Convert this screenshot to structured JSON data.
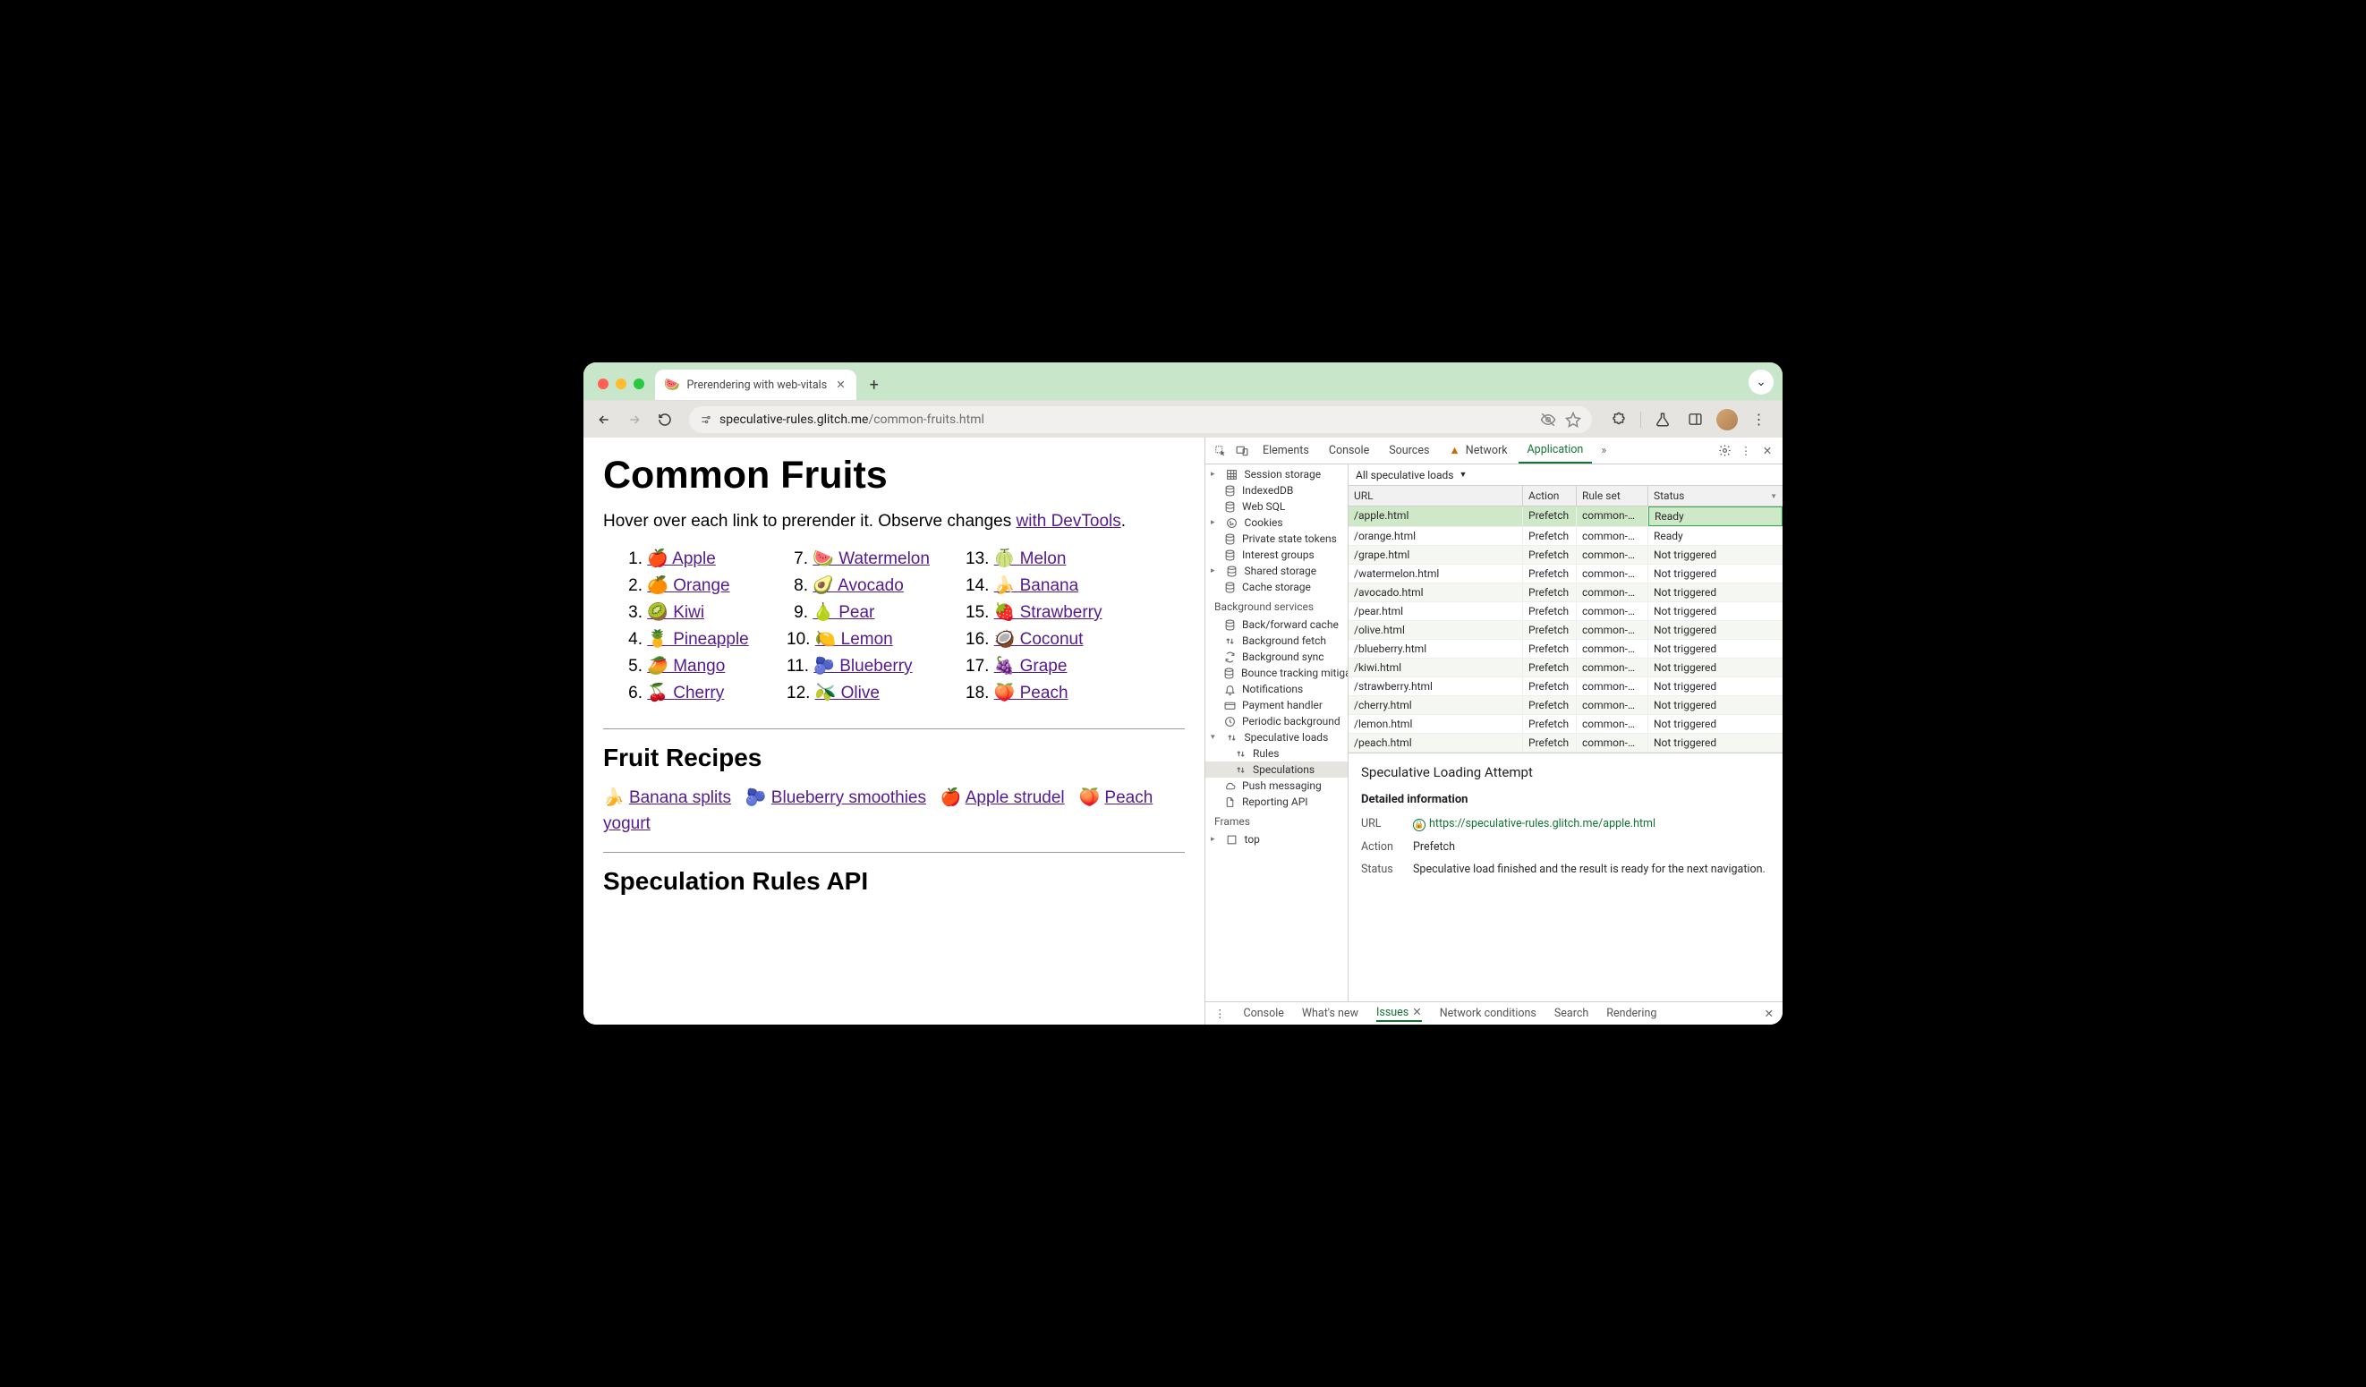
{
  "tab": {
    "title": "Prerendering with web-vitals",
    "favicon": "🍉"
  },
  "omnibox": {
    "host": "speculative-rules.glitch.me",
    "path": "/common-fruits.html"
  },
  "page": {
    "h1": "Common Fruits",
    "intro_before": "Hover over each link to prerender it. Observe changes ",
    "intro_link": "with DevTools",
    "intro_after": ".",
    "fruits_col1": [
      {
        "n": "1.",
        "e": "🍎",
        "t": "Apple"
      },
      {
        "n": "2.",
        "e": "🍊",
        "t": "Orange"
      },
      {
        "n": "3.",
        "e": "🥝",
        "t": "Kiwi"
      },
      {
        "n": "4.",
        "e": "🍍",
        "t": "Pineapple"
      },
      {
        "n": "5.",
        "e": "🥭",
        "t": "Mango"
      },
      {
        "n": "6.",
        "e": "🍒",
        "t": "Cherry"
      }
    ],
    "fruits_col2": [
      {
        "n": "7.",
        "e": "🍉",
        "t": "Watermelon"
      },
      {
        "n": "8.",
        "e": "🥑",
        "t": "Avocado"
      },
      {
        "n": "9.",
        "e": "🍐",
        "t": "Pear"
      },
      {
        "n": "10.",
        "e": "🍋",
        "t": "Lemon"
      },
      {
        "n": "11.",
        "e": "🫐",
        "t": "Blueberry"
      },
      {
        "n": "12.",
        "e": "🫒",
        "t": "Olive"
      }
    ],
    "fruits_col3": [
      {
        "n": "13.",
        "e": "🍈",
        "t": "Melon"
      },
      {
        "n": "14.",
        "e": "🍌",
        "t": "Banana"
      },
      {
        "n": "15.",
        "e": "🍓",
        "t": "Strawberry"
      },
      {
        "n": "16.",
        "e": "🥥",
        "t": "Coconut"
      },
      {
        "n": "17.",
        "e": "🍇",
        "t": "Grape"
      },
      {
        "n": "18.",
        "e": "🍑",
        "t": "Peach"
      }
    ],
    "h2a": "Fruit Recipes",
    "recipes": [
      {
        "e": "🍌",
        "t": "Banana splits"
      },
      {
        "e": "🫐",
        "t": "Blueberry smoothies"
      },
      {
        "e": "🍎",
        "t": "Apple strudel"
      },
      {
        "e": "🍑",
        "t": "Peach yogurt"
      }
    ],
    "h2b": "Speculation Rules API"
  },
  "devtools": {
    "tabs": [
      "Elements",
      "Console",
      "Sources",
      "Network",
      "Application"
    ],
    "activeTab": "Application",
    "moreIcon": "»",
    "storage": [
      {
        "label": "Session storage",
        "caret": true,
        "icon": "grid"
      },
      {
        "label": "IndexedDB",
        "icon": "db"
      },
      {
        "label": "Web SQL",
        "icon": "db"
      },
      {
        "label": "Cookies",
        "caret": true,
        "icon": "cookie"
      },
      {
        "label": "Private state tokens",
        "icon": "db"
      },
      {
        "label": "Interest groups",
        "icon": "db"
      },
      {
        "label": "Shared storage",
        "caret": true,
        "icon": "db"
      },
      {
        "label": "Cache storage",
        "icon": "db"
      }
    ],
    "bgHeading": "Background services",
    "bg": [
      {
        "label": "Back/forward cache",
        "icon": "db"
      },
      {
        "label": "Background fetch",
        "icon": "updown"
      },
      {
        "label": "Background sync",
        "icon": "sync"
      },
      {
        "label": "Bounce tracking mitigation",
        "icon": "db"
      },
      {
        "label": "Notifications",
        "icon": "bell"
      },
      {
        "label": "Payment handler",
        "icon": "card"
      },
      {
        "label": "Periodic background",
        "icon": "clock"
      },
      {
        "label": "Speculative loads",
        "icon": "updown",
        "caret": true,
        "open": true
      },
      {
        "label": "Rules",
        "sub": true,
        "icon": "updown"
      },
      {
        "label": "Speculations",
        "sub": true,
        "icon": "updown",
        "selected": true
      },
      {
        "label": "Push messaging",
        "icon": "cloud"
      },
      {
        "label": "Reporting API",
        "icon": "doc"
      }
    ],
    "framesHeading": "Frames",
    "frames": [
      {
        "label": "top",
        "caret": true,
        "icon": "frame"
      }
    ],
    "filterLabel": "All speculative loads",
    "columns": {
      "url": "URL",
      "action": "Action",
      "ruleset": "Rule set",
      "status": "Status"
    },
    "rows": [
      {
        "url": "/apple.html",
        "action": "Prefetch",
        "ruleset": "common-…",
        "status": "Ready",
        "selected": true
      },
      {
        "url": "/orange.html",
        "action": "Prefetch",
        "ruleset": "common-…",
        "status": "Ready"
      },
      {
        "url": "/grape.html",
        "action": "Prefetch",
        "ruleset": "common-…",
        "status": "Not triggered"
      },
      {
        "url": "/watermelon.html",
        "action": "Prefetch",
        "ruleset": "common-…",
        "status": "Not triggered"
      },
      {
        "url": "/avocado.html",
        "action": "Prefetch",
        "ruleset": "common-…",
        "status": "Not triggered"
      },
      {
        "url": "/pear.html",
        "action": "Prefetch",
        "ruleset": "common-…",
        "status": "Not triggered"
      },
      {
        "url": "/olive.html",
        "action": "Prefetch",
        "ruleset": "common-…",
        "status": "Not triggered"
      },
      {
        "url": "/blueberry.html",
        "action": "Prefetch",
        "ruleset": "common-…",
        "status": "Not triggered"
      },
      {
        "url": "/kiwi.html",
        "action": "Prefetch",
        "ruleset": "common-…",
        "status": "Not triggered"
      },
      {
        "url": "/strawberry.html",
        "action": "Prefetch",
        "ruleset": "common-…",
        "status": "Not triggered"
      },
      {
        "url": "/cherry.html",
        "action": "Prefetch",
        "ruleset": "common-…",
        "status": "Not triggered"
      },
      {
        "url": "/lemon.html",
        "action": "Prefetch",
        "ruleset": "common-…",
        "status": "Not triggered"
      },
      {
        "url": "/peach.html",
        "action": "Prefetch",
        "ruleset": "common-…",
        "status": "Not triggered"
      }
    ],
    "detail": {
      "title": "Speculative Loading Attempt",
      "subtitle": "Detailed information",
      "urlLabel": "URL",
      "urlValue": "https://speculative-rules.glitch.me/apple.html",
      "actionLabel": "Action",
      "actionValue": "Prefetch",
      "statusLabel": "Status",
      "statusValue": "Speculative load finished and the result is ready for the next navigation."
    },
    "drawer": [
      "Console",
      "What's new",
      "Issues",
      "Network conditions",
      "Search",
      "Rendering"
    ],
    "drawerActive": "Issues"
  }
}
